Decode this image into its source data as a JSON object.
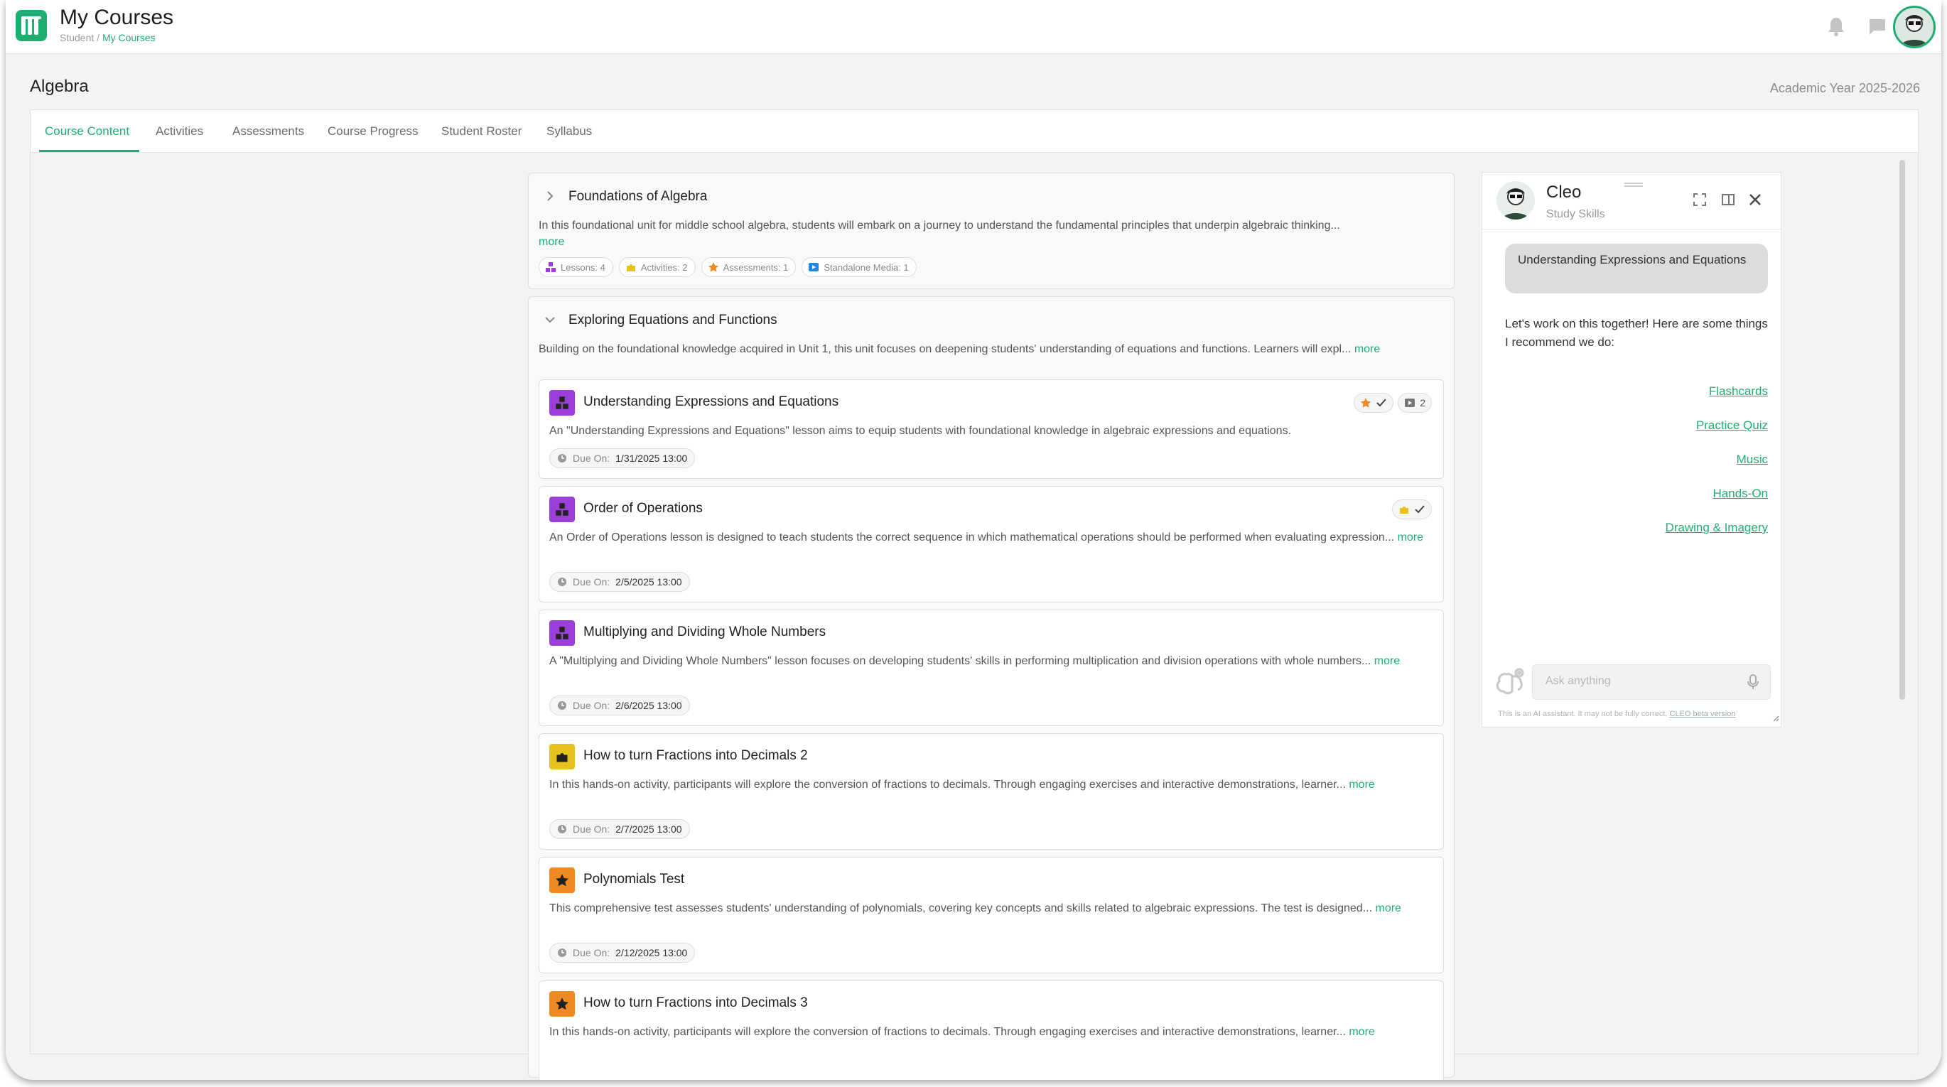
{
  "app": {
    "title": "My Courses",
    "breadcrumb": [
      "Student",
      "My Courses"
    ],
    "accent": "#1fae72"
  },
  "page": {
    "title": "Algebra",
    "academic_year": "Academic Year 2025-2026"
  },
  "tabs": [
    "Course Content",
    "Activities",
    "Assessments",
    "Course Progress",
    "Student Roster",
    "Syllabus"
  ],
  "units": [
    {
      "title": "Foundations of Algebra",
      "description": "In this foundational unit for middle school algebra, students will embark on a journey to understand the fundamental principles that underpin algebraic thinking...",
      "more": "more",
      "chips": {
        "lessons": "Lessons: 4",
        "activities": "Activities: 2",
        "assessments": "Assessments: 1",
        "media": "Standalone Media: 1"
      }
    },
    {
      "title": "Exploring Equations and Functions",
      "description": "Building on the foundational knowledge acquired in Unit 1, this unit focuses on deepening students' understanding of equations and functions. Learners will expl...",
      "more": "more",
      "items": [
        {
          "type": "lesson",
          "title": "Understanding Expressions and Equations",
          "description": "An \"Understanding Expressions and Equations\" lesson aims to equip students with foundational knowledge in algebraic expressions and equations.",
          "more": "",
          "due_label": "Due On:",
          "due": "1/31/2025 13:00",
          "media_count": "2"
        },
        {
          "type": "lesson",
          "title": "Order of Operations",
          "description": "An Order of Operations lesson is designed to teach students the correct sequence in which mathematical operations should be performed when evaluating expression...",
          "more": "more",
          "due_label": "Due On:",
          "due": "2/5/2025 13:00"
        },
        {
          "type": "lesson",
          "title": "Multiplying and Dividing Whole Numbers",
          "description": "A \"Multiplying and Dividing Whole Numbers\" lesson focuses on developing students' skills in performing multiplication and division operations with whole numbers...",
          "more": "more",
          "due_label": "Due On:",
          "due": "2/6/2025 13:00"
        },
        {
          "type": "activity",
          "title": "How to turn Fractions into Decimals 2",
          "description": "In this hands-on activity, participants will explore the conversion of fractions to decimals. Through engaging exercises and interactive demonstrations, learner...",
          "more": "more",
          "due_label": "Due On:",
          "due": "2/7/2025 13:00"
        },
        {
          "type": "assessment",
          "title": "Polynomials Test",
          "description": "This comprehensive test assesses students' understanding of polynomials, covering key concepts and skills related to algebraic expressions. The test is designed...",
          "more": "more",
          "due_label": "Due On:",
          "due": "2/12/2025 13:00"
        },
        {
          "type": "assessment",
          "title": "How to turn Fractions into Decimals 3",
          "description": "In this hands-on activity, participants will explore the conversion of fractions to decimals. Through engaging exercises and interactive demonstrations, learner...",
          "more": "more"
        }
      ]
    }
  ],
  "chat": {
    "name": "Cleo",
    "subtitle": "Study Skills",
    "user_message": "Understanding Expressions and Equations",
    "reply": "Let's work on this together! Here are some things I recommend we do:",
    "links": [
      "Flashcards",
      "Practice Quiz",
      "Music",
      "Hands-On",
      "Drawing & Imagery"
    ],
    "input_placeholder": "Ask anything",
    "disclaimer": "This is an AI assistant. It may not be fully correct.",
    "beta_link": "CLEO beta version"
  },
  "colors": {
    "lesson": "#9b3fd8",
    "activity": "#e6c21e",
    "assessment": "#ef8a23",
    "media": "#1e88e5"
  },
  "icons": [
    "bell-icon",
    "chat-bubble-icon",
    "chevron-right-icon",
    "chevron-down-icon",
    "lesson-blocks-icon",
    "puzzle-icon",
    "star-icon",
    "check-icon",
    "media-icon",
    "clock-icon",
    "expand-icon",
    "sidebar-icon",
    "close-icon",
    "microphone-icon",
    "cleo-brain-icon"
  ]
}
